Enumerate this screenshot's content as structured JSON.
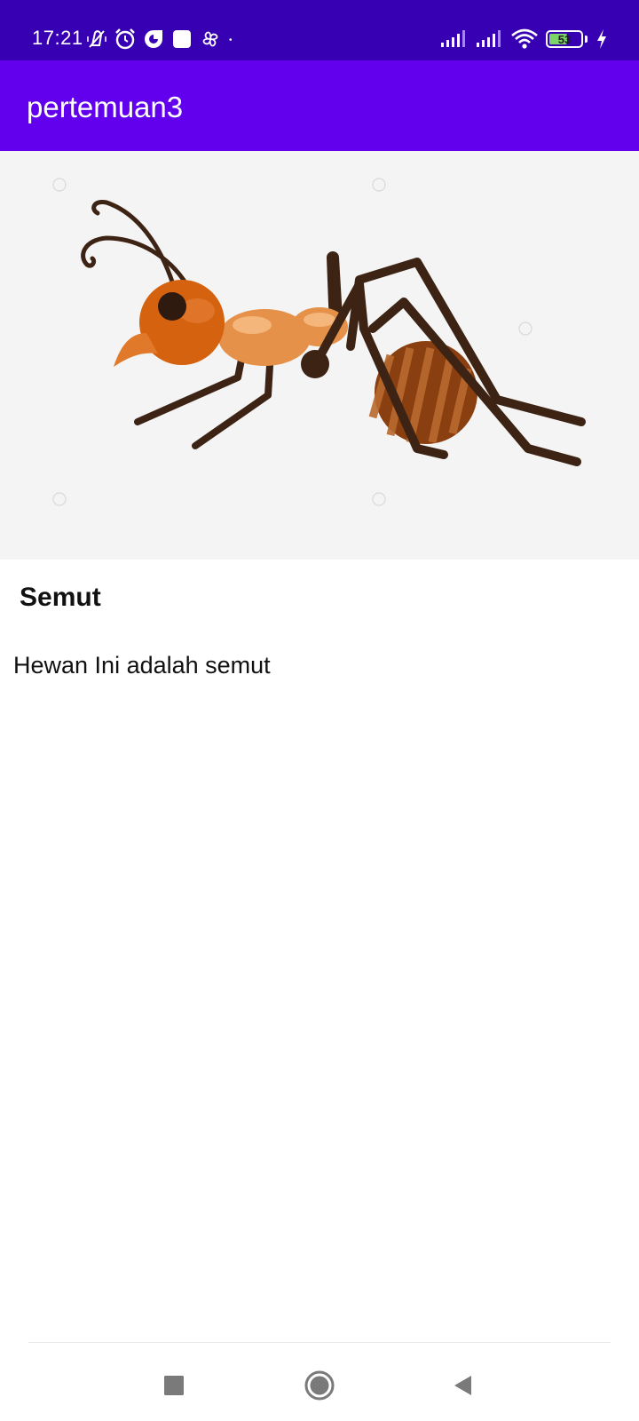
{
  "status_bar": {
    "time": "17:21",
    "battery_level": "53",
    "left_icons": [
      "mute-vibrate-icon",
      "alarm-icon",
      "data-saver-icon",
      "square-notification-icon",
      "pinwheel-icon",
      "dot-icon"
    ],
    "right_icons": [
      "signal-icon",
      "signal-icon",
      "wifi-icon",
      "battery-icon",
      "charging-icon"
    ],
    "colors": {
      "background": "#3700b3",
      "battery_fill": "#7bd36a"
    }
  },
  "app_bar": {
    "title": "pertemuan3",
    "color": "#6200ee"
  },
  "content": {
    "image": {
      "subject": "ant illustration",
      "watermark": "pngtree"
    },
    "name": "Semut",
    "description": "Hewan Ini adalah semut"
  },
  "nav_bar": {
    "buttons": [
      "recent-apps-icon",
      "home-icon",
      "back-icon"
    ]
  }
}
